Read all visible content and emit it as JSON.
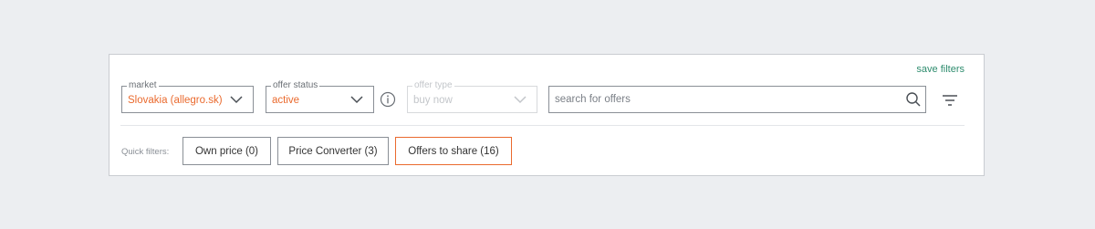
{
  "toolbar": {
    "save_filters_label": "save filters"
  },
  "filters": {
    "market": {
      "label": "market",
      "value": "Slovakia (allegro.sk)"
    },
    "offer_status": {
      "label": "offer status",
      "value": "active"
    },
    "offer_type": {
      "label": "offer type",
      "value": "buy now",
      "disabled": true
    }
  },
  "search": {
    "placeholder": "search for offers",
    "value": ""
  },
  "quick_filters": {
    "label": "Quick filters:",
    "items": [
      {
        "label": "Own price (0)",
        "active": false
      },
      {
        "label": "Price Converter (3)",
        "active": false
      },
      {
        "label": "Offers to share (16)",
        "active": true
      }
    ]
  },
  "colors": {
    "accent": "#ea6a2e",
    "link": "#2e8c6e",
    "border": "#8a8f96",
    "background": "#eceef1"
  },
  "icons": [
    "chevron-down-icon",
    "info-icon",
    "search-icon",
    "filter-icon"
  ]
}
